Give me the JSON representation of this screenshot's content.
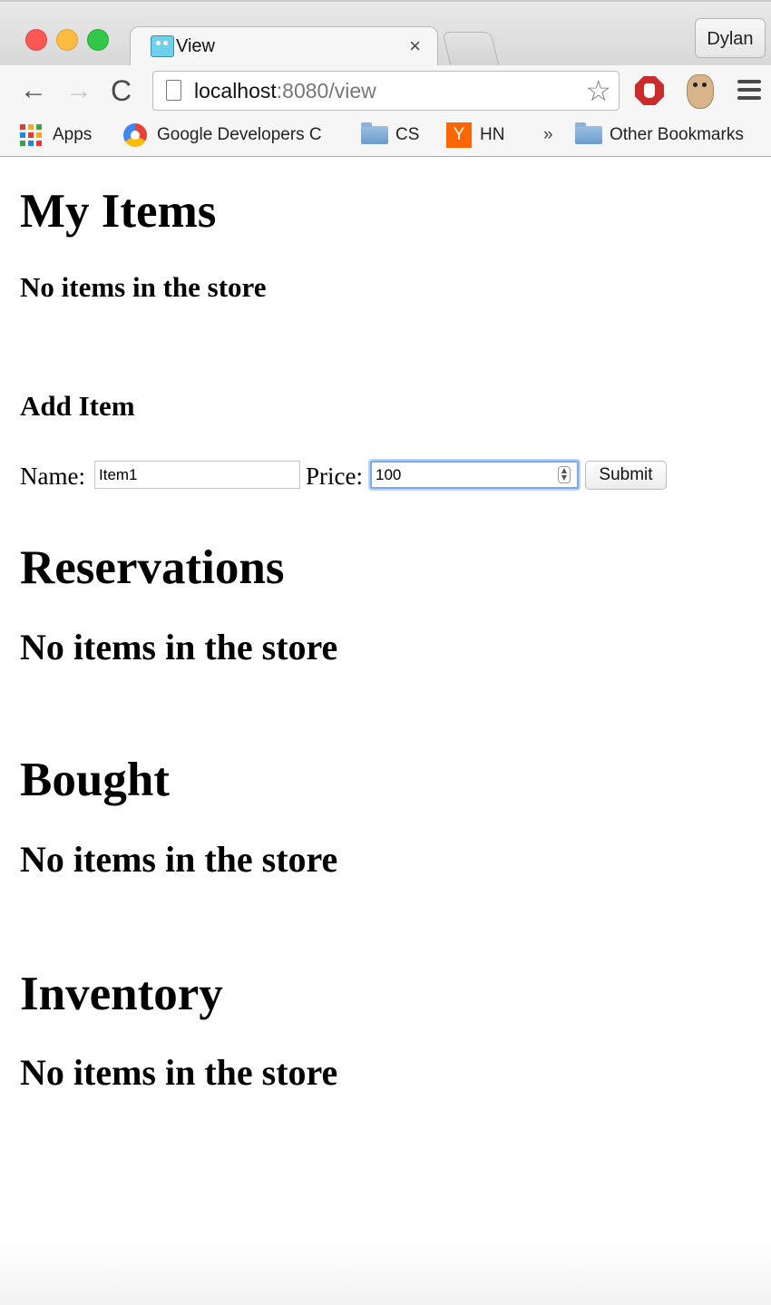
{
  "browser": {
    "tab_title": "View",
    "tab_close": "×",
    "profile_name": "Dylan",
    "url_host": "localhost",
    "url_rest": ":8080/view",
    "bookmarks": {
      "apps": "Apps",
      "google_dev": "Google Developers C",
      "cs": "CS",
      "hn_icon": "Y",
      "hn": "HN",
      "overflow": "»",
      "other": "Other Bookmarks"
    },
    "icons": {
      "back": "←",
      "forward": "→",
      "reload": "C",
      "star": "☆"
    }
  },
  "page": {
    "my_items_title": "My Items",
    "my_items_empty": "No items in the store",
    "add_item_title": "Add Item",
    "form": {
      "name_label": "Name:",
      "name_value": "Item1",
      "price_label": "Price:",
      "price_value": "100",
      "submit_label": "Submit"
    },
    "reservations_title": "Reservations",
    "reservations_empty": "No items in the store",
    "bought_title": "Bought",
    "bought_empty": "No items in the store",
    "inventory_title": "Inventory",
    "inventory_empty": "No items in the store"
  }
}
